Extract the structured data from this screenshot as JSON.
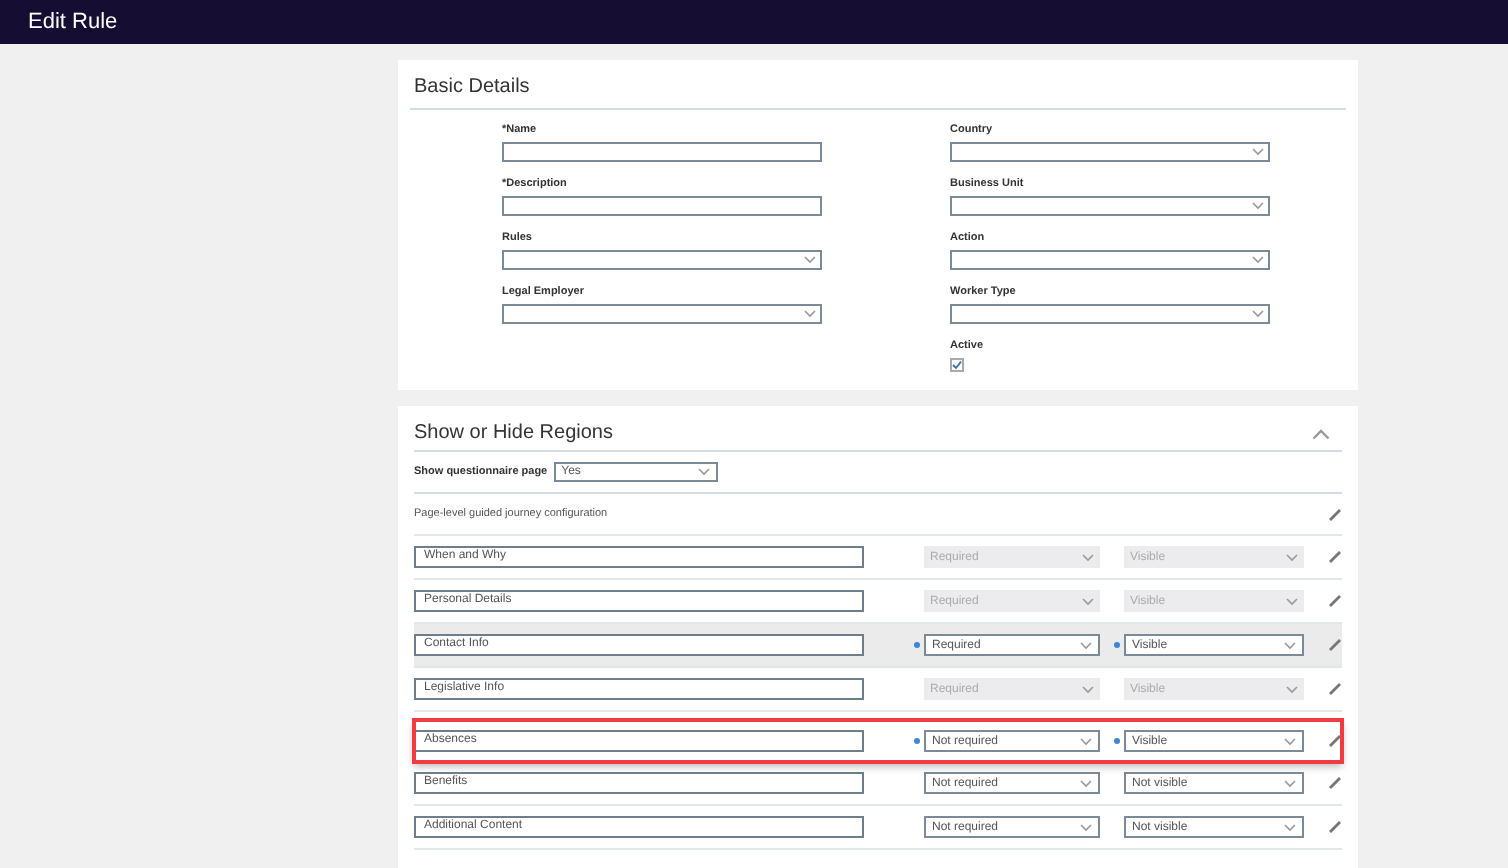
{
  "header": {
    "title": "Edit Rule"
  },
  "basic_details": {
    "title": "Basic Details",
    "left_fields": [
      {
        "label": "*Name",
        "kind": "text"
      },
      {
        "label": "*Description",
        "kind": "text"
      },
      {
        "label": "Rules",
        "kind": "select"
      },
      {
        "label": "Legal Employer",
        "kind": "select"
      }
    ],
    "right_fields": [
      {
        "label": "Country",
        "kind": "select"
      },
      {
        "label": "Business Unit",
        "kind": "select"
      },
      {
        "label": "Action",
        "kind": "select"
      },
      {
        "label": "Worker Type",
        "kind": "select"
      },
      {
        "label": "Active",
        "kind": "checkbox",
        "checked": true
      }
    ]
  },
  "regions": {
    "title": "Show or Hide Regions",
    "expanded": true,
    "questionnaire": {
      "label": "Show questionnaire page",
      "value": "Yes"
    },
    "config_label": "Page-level guided journey configuration",
    "rows": [
      {
        "name": "When and Why",
        "requirement": "Required",
        "visibility": "Visible",
        "disabled": true,
        "hovered": false,
        "highlighted": false,
        "changed": false
      },
      {
        "name": "Personal Details",
        "requirement": "Required",
        "visibility": "Visible",
        "disabled": true,
        "hovered": false,
        "highlighted": false,
        "changed": false
      },
      {
        "name": "Contact Info",
        "requirement": "Required",
        "visibility": "Visible",
        "disabled": false,
        "hovered": true,
        "highlighted": false,
        "changed": true
      },
      {
        "name": "Legislative Info",
        "requirement": "Required",
        "visibility": "Visible",
        "disabled": true,
        "hovered": false,
        "highlighted": false,
        "changed": false
      },
      {
        "name": "Absences",
        "requirement": "Not required",
        "visibility": "Visible",
        "disabled": false,
        "hovered": false,
        "highlighted": true,
        "changed": true
      },
      {
        "name": "Benefits",
        "requirement": "Not required",
        "visibility": "Not visible",
        "disabled": false,
        "hovered": false,
        "highlighted": false,
        "changed": false
      },
      {
        "name": "Additional Content",
        "requirement": "Not required",
        "visibility": "Not visible",
        "disabled": false,
        "hovered": false,
        "highlighted": false,
        "changed": false
      }
    ]
  }
}
